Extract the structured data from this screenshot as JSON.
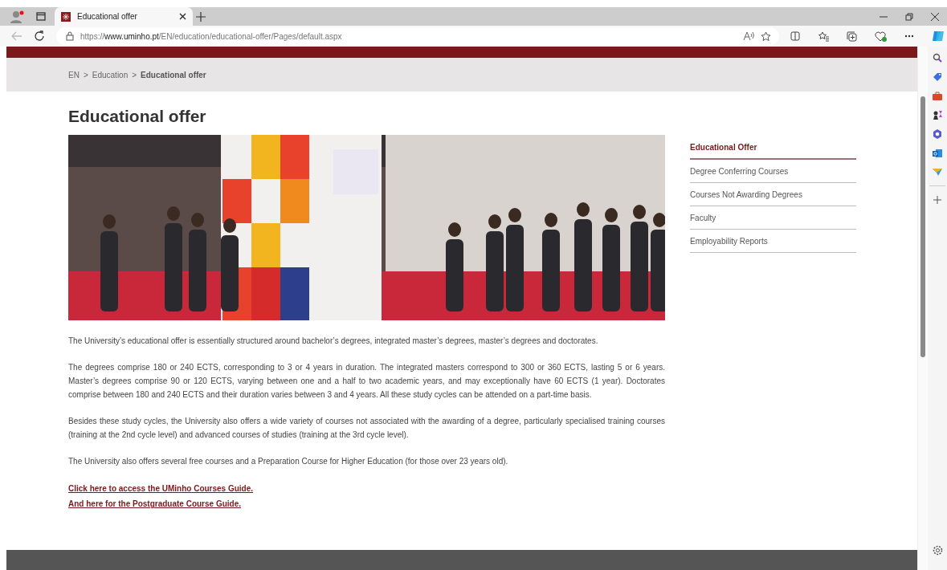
{
  "browser": {
    "tab": {
      "title": "Educational offer",
      "selected": true
    },
    "url": {
      "scheme": "https://",
      "host": "www.uminho.pt",
      "path": "/EN/education/educational-offer/Pages/default.aspx"
    }
  },
  "breadcrumb": [
    {
      "label": "EN",
      "current": false
    },
    {
      "separator": ">",
      "label": "Education",
      "current": false
    },
    {
      "separator": ">",
      "label": "Educational offer",
      "current": true
    }
  ],
  "page_title": "Educational offer",
  "hero": {
    "kind": "picture"
  },
  "paragraphs": [
    "The University’s educational offer is essentially structured around bachelor’s degrees, integrated master’s degrees, master’s degrees and doctorates.",
    "The degrees comprise 180 or 240 ECTS, corresponding to 3 or 4 years in duration. The integrated masters correspond to 300 or 360 ECTS, lasting 5 or 6 years. Master’s degrees comprise 90 or 120 ECTS, varying between one and a half to two academic years, and may exceptionally have 60 ECTS (1 year). Doctorates comprise between 180 and 240 ECTS and their duration varies between 3 and 4 years. All these study cycles can be attended on a part-time basis.",
    "Besides these study cycles, the University also offers a wide variety of courses not associated with the awarding of a degree, particularly specialised training courses (training at the 2nd cycle level) and advanced courses of studies (training at the 3rd cycle level).",
    "The University also offers several free courses and a Preparation Course for Higher Education (for those over 23 years old)."
  ],
  "links": [
    "Click here to access the UMinho Courses Guide.",
    "And here for the Postgraduate Course Guide."
  ],
  "side_nav": [
    {
      "label": "Educational Offer",
      "selected": true
    },
    {
      "label": "Degree Conferring Courses",
      "selected": false
    },
    {
      "label": "Courses Not Awarding Degrees",
      "selected": false
    },
    {
      "label": "Faculty",
      "selected": false
    },
    {
      "label": "Employability Reports",
      "selected": false
    }
  ]
}
